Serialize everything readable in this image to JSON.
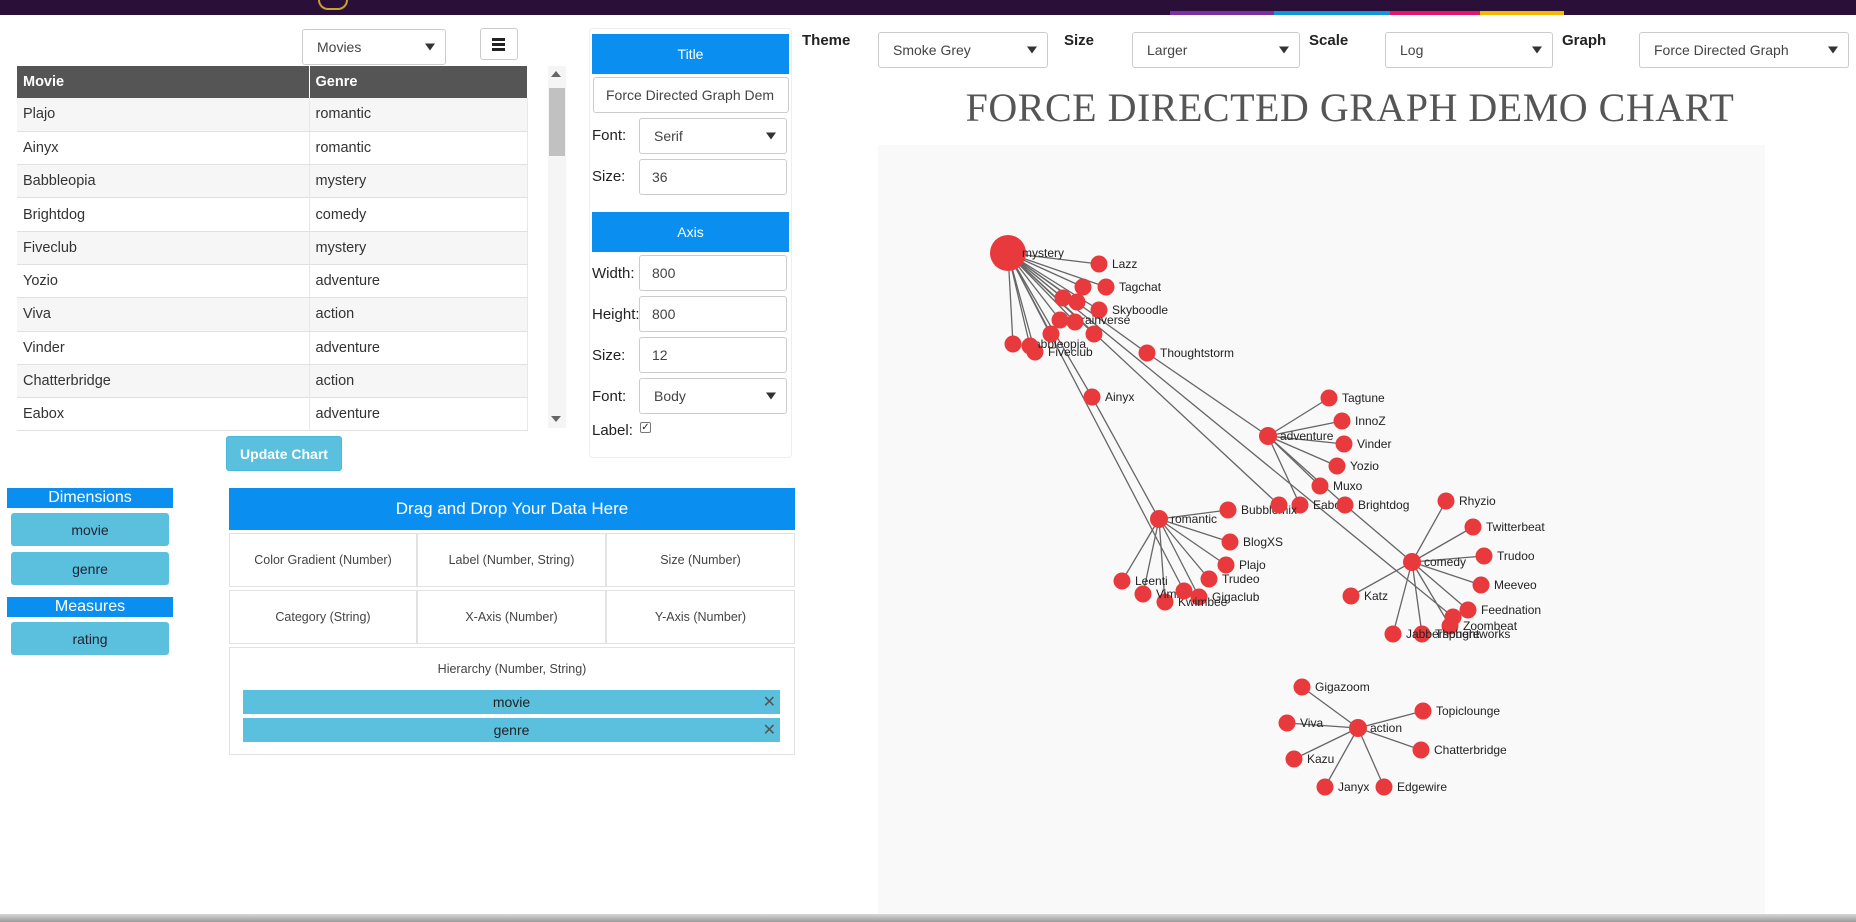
{
  "colors": {
    "accent": "#0a8ff0",
    "chip": "#5bc0de",
    "node": "#e8393d",
    "link": "#666666",
    "table_header": "#555555",
    "topbar": "#2a1038",
    "stripe_purple": "#7b2fa3",
    "stripe_blue": "#1296db",
    "stripe_pink": "#e4156b",
    "stripe_yellow": "#f5b800"
  },
  "dataset_select": {
    "value": "Movies",
    "icon": "list-icon"
  },
  "table": {
    "columns": [
      "Movie",
      "Genre"
    ],
    "rows": [
      [
        "Plajo",
        "romantic"
      ],
      [
        "Ainyx",
        "romantic"
      ],
      [
        "Babbleopia",
        "mystery"
      ],
      [
        "Brightdog",
        "comedy"
      ],
      [
        "Fiveclub",
        "mystery"
      ],
      [
        "Yozio",
        "adventure"
      ],
      [
        "Viva",
        "action"
      ],
      [
        "Vinder",
        "adventure"
      ],
      [
        "Chatterbridge",
        "action"
      ],
      [
        "Eabox",
        "adventure"
      ]
    ]
  },
  "update_button": "Update Chart",
  "dimensions": {
    "title": "Dimensions",
    "items": [
      "movie",
      "genre"
    ]
  },
  "measures": {
    "title": "Measures",
    "items": [
      "rating"
    ]
  },
  "dropzone": {
    "title": "Drag and Drop Your Data Here",
    "cells": [
      "Color Gradient (Number)",
      "Label (Number, String)",
      "Size (Number)",
      "Category (String)",
      "X-Axis (Number)",
      "Y-Axis (Number)"
    ],
    "hierarchy_title": "Hierarchy (Number, String)",
    "hierarchy_items": [
      "movie",
      "genre"
    ],
    "remove_icon": "close-icon",
    "remove_glyph": "✕"
  },
  "title_panel": {
    "header": "Title",
    "text_value": "Force Directed Graph Dem",
    "font_label": "Font:",
    "font_value": "Serif",
    "size_label": "Size:",
    "size_value": "36"
  },
  "axis_panel": {
    "header": "Axis",
    "width_label": "Width:",
    "width_value": "800",
    "height_label": "Height:",
    "height_value": "800",
    "size_label": "Size:",
    "size_value": "12",
    "font_label": "Font:",
    "font_value": "Body",
    "label_label": "Label:",
    "label_checked": true,
    "check_glyph": "✓"
  },
  "options": {
    "theme_label": "Theme",
    "theme_value": "Smoke Grey",
    "size_label": "Size",
    "size_value": "Larger",
    "scale_label": "Scale",
    "scale_value": "Log",
    "graph_label": "Graph",
    "graph_value": "Force Directed Graph"
  },
  "chart_title": "FORCE DIRECTED GRAPH DEMO CHART",
  "chart_data": {
    "type": "force-directed-graph",
    "groups": [
      {
        "name": "mystery",
        "emphasized": true,
        "members": [
          "Lazz",
          "Tagchat",
          "Skyboodle",
          "Brainverse",
          "Fiveclub",
          "Babbleopia",
          "Thoughtstorm",
          "Ainyx"
        ]
      },
      {
        "name": "adventure",
        "members": [
          "Tagtune",
          "InnoZ",
          "Vinder",
          "Yozio",
          "Muxo",
          "Eabox",
          "Thoughtstorm",
          "Brightdog"
        ]
      },
      {
        "name": "romantic",
        "members": [
          "Ainyx",
          "Bubblemix",
          "BlogXS",
          "Plajo",
          "Trudeo",
          "Gigaclub",
          "Kwimbee",
          "Vimbo",
          "Leenti"
        ]
      },
      {
        "name": "comedy",
        "members": [
          "Rhyzio",
          "Twitterbeat",
          "Trudoo",
          "Meeveo",
          "Feednation",
          "Zoombeat",
          "Thoughtworks",
          "Jabbersphere",
          "Katz",
          "Brightdog"
        ]
      },
      {
        "name": "action",
        "members": [
          "Gigazoom",
          "Viva",
          "Topiclounge",
          "Chatterbridge",
          "Kazu",
          "Janyx",
          "Edgewire"
        ]
      }
    ]
  }
}
